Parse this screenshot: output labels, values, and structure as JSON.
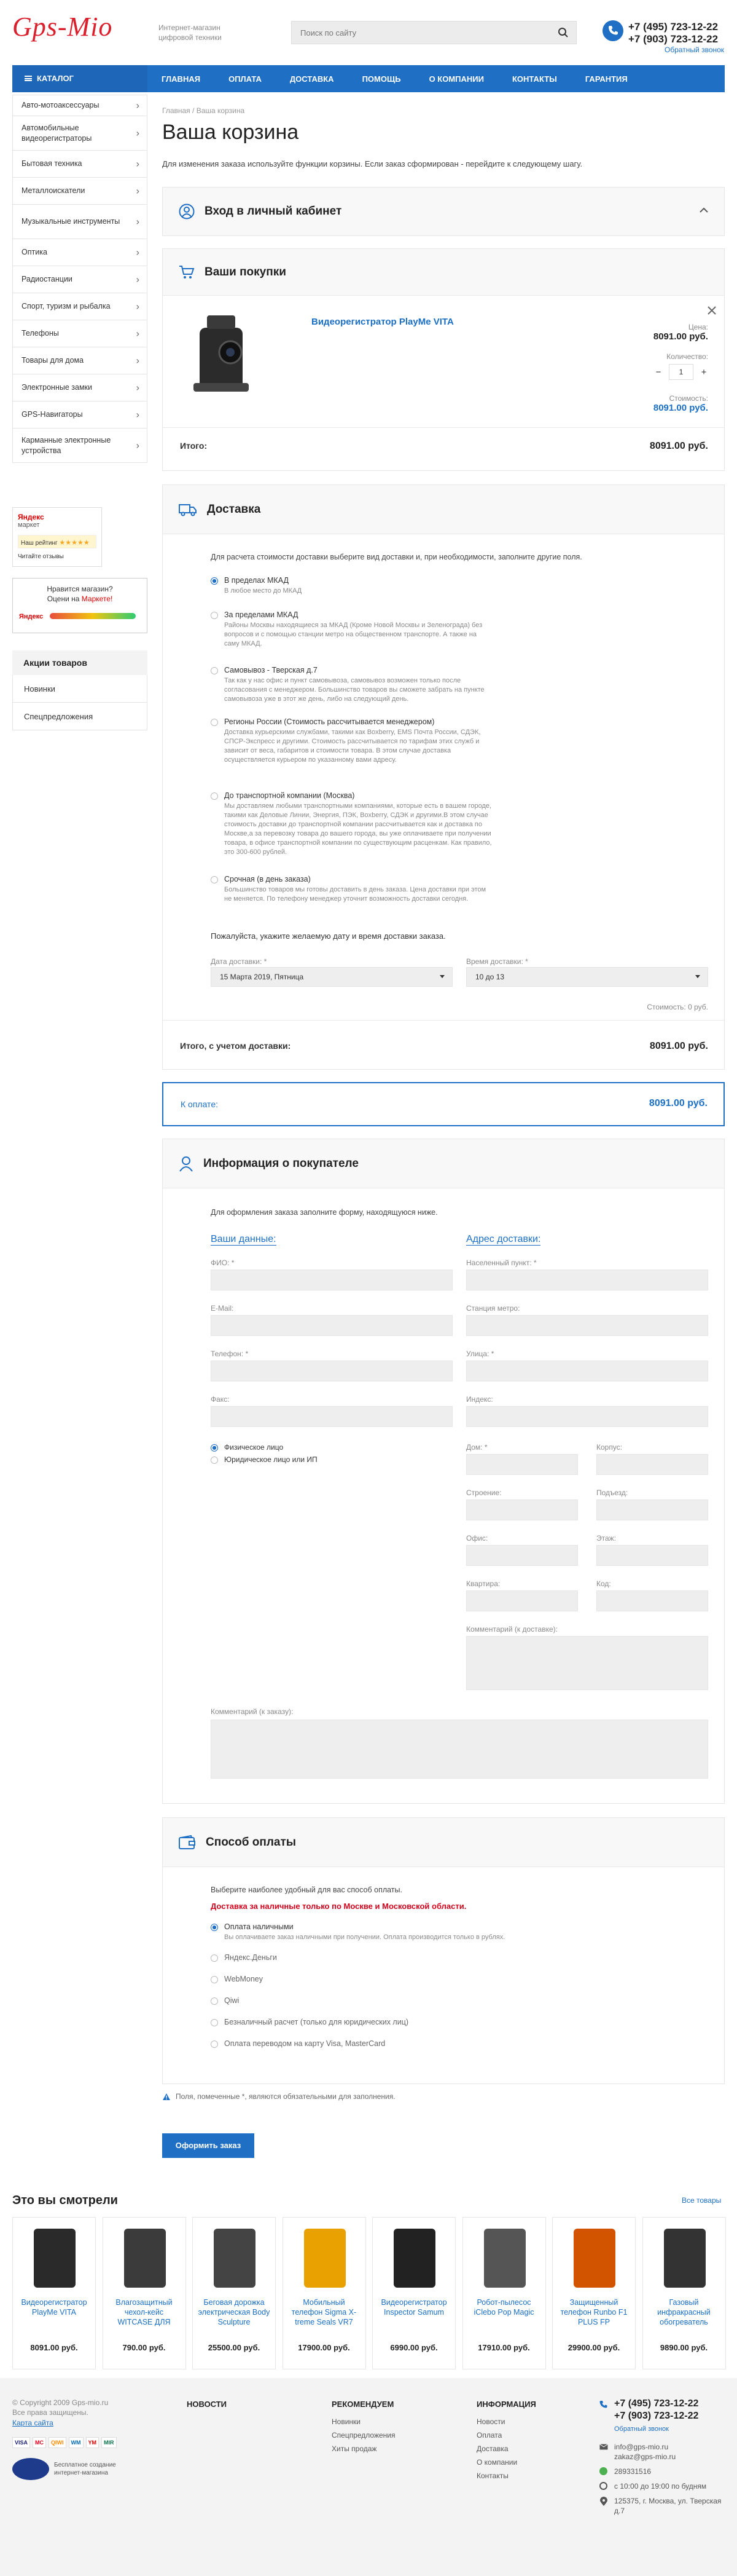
{
  "header": {
    "logo": "Gps-Mio",
    "tagline": "Интернет-магазин цифровой техники",
    "search_placeholder": "Поиск по сайту",
    "phone1": "+7 (495) 723-12-22",
    "phone2": "+7 (903) 723-12-22",
    "callback": "Обратный звонок"
  },
  "nav": {
    "catalog": "КАТАЛОГ",
    "items": [
      "ГЛАВНАЯ",
      "ОПЛАТА",
      "ДОСТАВКА",
      "ПОМОЩЬ",
      "О КОМПАНИИ",
      "КОНТАКТЫ",
      "ГАРАНТИЯ"
    ]
  },
  "sidebar": {
    "items": [
      "Авто-мотоаксессуары",
      "Автомобильные видеорегистраторы",
      "Бытовая техника",
      "Металлоискатели",
      "Музыкальные инструменты",
      "Оптика",
      "Радиостанции",
      "Спорт, туризм и рыбалка",
      "Телефоны",
      "Товары для дома",
      "Электронные замки",
      "GPS-Навигаторы",
      "Карманные электронные устройства"
    ],
    "yandex": "Яндекс",
    "market": "маркет",
    "our_rating": "Наш рейтинг",
    "read_reviews": "Читайте отзывы",
    "like_shop": "Нравится магазин?",
    "rate_on": "Оцени на",
    "market2": "Маркете!",
    "actions_title": "Акции товаров",
    "actions": [
      "Новинки",
      "Спецпредложения"
    ]
  },
  "page": {
    "breadcrumb": [
      "Главная",
      "Ваша корзина"
    ],
    "title": "Ваша корзина",
    "intro": "Для изменения заказа используйте функции корзины. Если заказ сформирован - перейдите к следующему шагу."
  },
  "login": {
    "title": "Вход в личный кабинет"
  },
  "cart": {
    "title": "Ваши покупки",
    "product": "Видеорегистратор PlayMe VITA",
    "price_label": "Цена:",
    "price": "8091.00 руб.",
    "qty_label": "Количество:",
    "qty": "1",
    "minus": "−",
    "plus": "+",
    "cost_label": "Стоимость:",
    "cost": "8091.00 руб.",
    "total_label": "Итого:",
    "total": "8091.00 руб."
  },
  "delivery": {
    "title": "Доставка",
    "hint": "Для расчета стоимости доставки выберите вид доставки и, при необходимости, заполните другие поля.",
    "options": [
      {
        "title": "В пределах МКАД",
        "desc": "В любое место до МКАД",
        "selected": true
      },
      {
        "title": "За пределами МКАД",
        "desc": "Районы Москвы находящиеся за МКАД (Кроме Новой Москвы и Зеленограда) без вопросов и с помощью станции метро на общественном транспорте. А также на саму МКАД.",
        "selected": false
      },
      {
        "title": "Самовывоз - Тверская д.7",
        "desc": "Так как у нас офис и пункт самовывоза, самовывоз возможен только после согласования с менеджером. Большинство товаров вы сможете забрать на пункте самовывоза уже в этот же день, либо на следующий день.",
        "selected": false
      },
      {
        "title": "Регионы России (Стоимость рассчитывается менеджером)",
        "desc": "Доставка курьерскими службами, такими как Boxberry, EMS Почта России, СДЭК, СПСР-Экспресс и другими. Стоимость рассчитывается по тарифам этих служб и зависит от веса, габаритов и стоимости товара. В этом случае доставка осуществляется курьером по указанному вами адресу.",
        "selected": false
      },
      {
        "title": "До транспортной компании (Москва)",
        "desc": "Мы доставляем любыми транспортными компаниями, которые есть в вашем городе, такими как Деловые Линии, Энергия, ПЭК, Boxberry, СДЭК и другими.В этом случае стоимость доставки до транспортной компании рассчитывается как и доставка по Москве,а за перевозку товара до вашего города, вы уже оплачиваете при получении товара, в офисе транспортной компании по существующим расценкам. Как правило, это 300-600 рублей.",
        "selected": false
      },
      {
        "title": "Срочная (в день заказа)",
        "desc": "Большинство товаров мы готовы доставить в день заказа. Цена доставки при этом не меняется. По телефону менеджер уточнит возможность доставки сегодня.",
        "selected": false
      }
    ],
    "date_prompt": "Пожалуйста, укажите желаемую дату и время доставки заказа.",
    "date_label": "Дата доставки: *",
    "date_value": "15 Марта 2019, Пятница",
    "time_label": "Время доставки: *",
    "time_value": "10 до 13",
    "cost_label": "Стоимость: 0 руб.",
    "total_label": "Итого, с учетом доставки:",
    "total": "8091.00 руб."
  },
  "payable": {
    "label": "К оплате:",
    "value": "8091.00 руб."
  },
  "buyer": {
    "title": "Информация о покупателе",
    "hint": "Для оформления заказа заполните форму, находящуюся ниже.",
    "left_title": "Ваши данные:",
    "right_title": "Адрес доставки:",
    "fio": "ФИО: *",
    "email": "E-Mail:",
    "phone": "Телефон: *",
    "fax": "Факс:",
    "person1": "Физическое лицо",
    "person2": "Юридическое лицо или ИП",
    "city": "Населенный пункт: *",
    "metro": "Станция метро:",
    "street": "Улица: *",
    "index": "Индекс:",
    "house": "Дом: *",
    "korpus": "Корпус:",
    "stroenie": "Строение:",
    "podezd": "Подъезд:",
    "office": "Офис:",
    "floor": "Этаж:",
    "flat": "Квартира:",
    "code": "Код:",
    "delivery_comment": "Комментарий (к доставке):",
    "order_comment": "Комментарий (к заказу):"
  },
  "payment": {
    "title": "Способ оплаты",
    "hint": "Выберите наиболее удобный для вас способ оплаты.",
    "warning": "Доставка за наличные только по Москве и Московской области.",
    "options": [
      {
        "title": "Оплата наличными",
        "desc": "Вы оплачиваете заказ наличными при получении. Оплата производится только в рублях.",
        "selected": true
      },
      {
        "title": "Яндекс.Деньги",
        "desc": "",
        "selected": false
      },
      {
        "title": "WebMoney",
        "desc": "",
        "selected": false
      },
      {
        "title": "Qiwi",
        "desc": "",
        "selected": false
      },
      {
        "title": "Безналичный расчет (только для юридических лиц)",
        "desc": "",
        "selected": false
      },
      {
        "title": "Оплата переводом на карту Visa, MasterCard",
        "desc": "",
        "selected": false
      }
    ],
    "required_note": "Поля, помеченные *, являются обязательными для заполнения.",
    "submit": "Оформить заказ"
  },
  "viewed": {
    "title": "Это вы смотрели",
    "all_link": "Все товары",
    "items": [
      {
        "name": "Видеорегистратор PlayMe VITA",
        "price": "8091.00 руб.",
        "color": "#2a2a2a"
      },
      {
        "name": "Влагозащитный чехол-кейс WITCASE ДЛЯ",
        "price": "790.00 руб.",
        "color": "#3b3b3b"
      },
      {
        "name": "Беговая дорожка электрическая Body Sculpture",
        "price": "25500.00 руб.",
        "color": "#444444"
      },
      {
        "name": "Мобильный телефон Sigma X-treme Seals VR7",
        "price": "17900.00 руб.",
        "color": "#e8a100"
      },
      {
        "name": "Видеорегистратор Inspector Samum",
        "price": "6990.00 руб.",
        "color": "#222222"
      },
      {
        "name": "Робот-пылесос iClebo Pop Magic",
        "price": "17910.00 руб.",
        "color": "#555555"
      },
      {
        "name": "Защищенный телефон Runbo F1 PLUS FP",
        "price": "29900.00 руб.",
        "color": "#d35400"
      },
      {
        "name": "Газовый инфракрасный обогреватель",
        "price": "9890.00 руб.",
        "color": "#333333"
      }
    ]
  },
  "footer": {
    "copyright": "© Copyright 2009 Gps-mio.ru",
    "rights": "Все права защищены.",
    "sitemap": "Карта сайта",
    "col1_title": "НОВОСТИ",
    "col2_title": "РЕКОМЕНДУЕМ",
    "col2_items": [
      "Новинки",
      "Спецпредложения",
      "Хиты продаж"
    ],
    "col3_title": "ИНФОРМАЦИЯ",
    "col3_items": [
      "Новости",
      "Оплата",
      "Доставка",
      "О компании",
      "Контакты"
    ],
    "phone1": "+7 (495) 723-12-22",
    "phone2": "+7 (903) 723-12-22",
    "callback": "Обратный звонок",
    "email1": "info@gps-mio.ru",
    "email2": "zakaz@gps-mio.ru",
    "icq": "289331516",
    "hours": "с 10:00 до 19:00 по будням",
    "address": "125375, г. Москва, ул. Тверская д.7",
    "payment_icons": [
      "VISA",
      "MC",
      "QIWI",
      "WM",
      "YM",
      "MIR"
    ],
    "eshop": "Бесплатное создание интернет-магазина"
  }
}
